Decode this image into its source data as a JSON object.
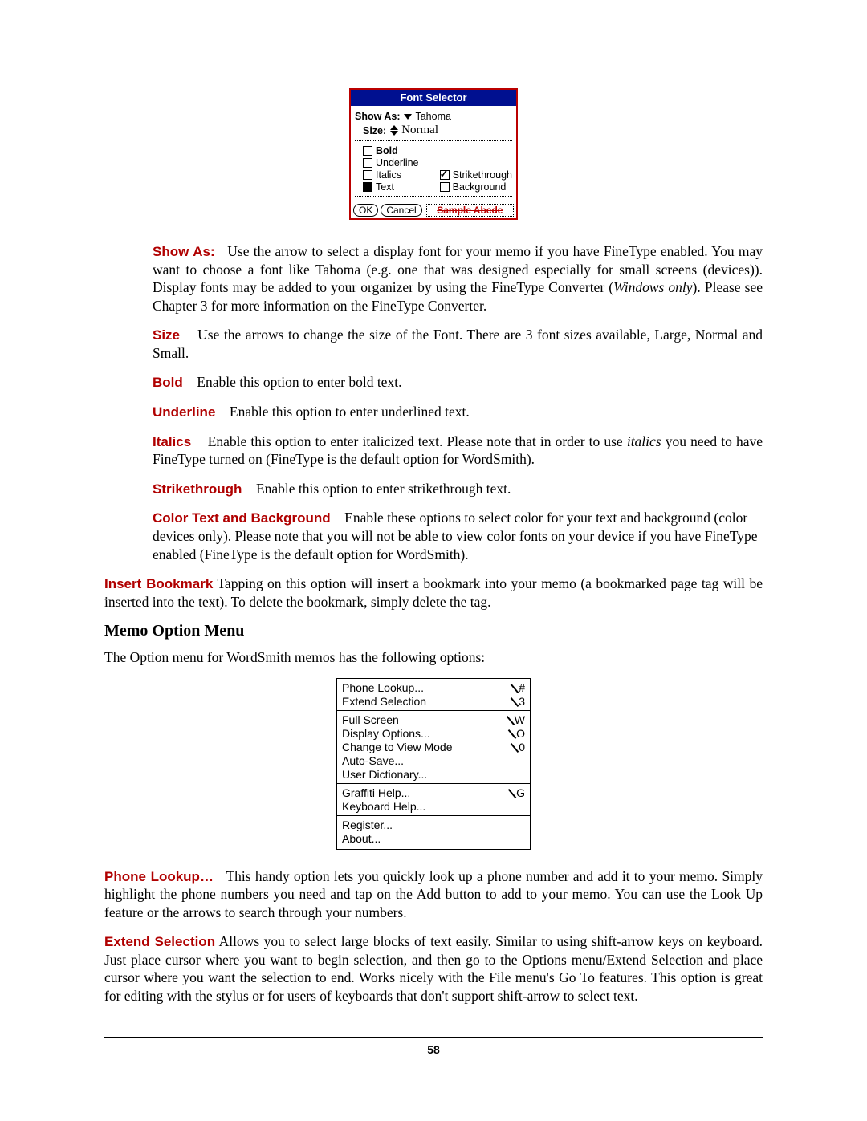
{
  "fontSelector": {
    "title": "Font Selector",
    "showAs": {
      "label": "Show As:",
      "value": "Tahoma"
    },
    "size": {
      "label": "Size:",
      "value": "Normal"
    },
    "left": {
      "bold": {
        "label": "Bold",
        "checked": false
      },
      "underline": {
        "label": "Underline",
        "checked": false
      },
      "italics": {
        "label": "Italics",
        "checked": false
      },
      "text": {
        "label": "Text",
        "filled": true
      }
    },
    "right": {
      "strike": {
        "label": "Strikethrough",
        "checked": true
      },
      "bg": {
        "label": "Background",
        "checked": false
      }
    },
    "ok": "OK",
    "cancel": "Cancel",
    "sample": "Sample   Abcde"
  },
  "p_showas": {
    "heading": "Show As:",
    "body1": "Use the arrow to select a display font for your memo if you have FineType enabled.  You may want to choose a font like Tahoma (e.g. one that was designed especially for small screens (devices)).  Display fonts may be added to your organizer by using the FineType Converter (",
    "italic": "Windows only",
    "body2": ").  Please see Chapter 3 for more information on the FineType Converter."
  },
  "p_size": {
    "heading": "Size",
    "body": "Use the arrows to change the size of the Font.  There are 3 font sizes available, Large, Normal and Small."
  },
  "p_bold": {
    "heading": "Bold",
    "body": "Enable this option to enter bold text."
  },
  "p_underline": {
    "heading": "Underline",
    "body": "Enable this option to enter underlined text."
  },
  "p_italics": {
    "heading": "Italics",
    "body1": "Enable this option to enter italicized text. Please note that in order to use ",
    "italic": "italics",
    "body2": " you need to have FineType turned on (FineType is the default option for WordSmith)."
  },
  "p_strike": {
    "heading": "Strikethrough",
    "body": "Enable this option to enter strikethrough text."
  },
  "p_color": {
    "heading": "Color Text and Background",
    "body": "Enable these options to select color for your text and background (color devices only).  Please note that you will not be able to view color fonts on your device if you have FineType enabled (FineType is the default option for WordSmith)."
  },
  "p_insert": {
    "heading": "Insert Bookmark",
    "body": " Tapping on this option will insert a bookmark into your memo (a bookmarked page tag will be inserted into the text).  To delete the bookmark, simply delete the tag."
  },
  "h_memo": "Memo Option Menu",
  "p_memo_intro": "The Option menu for WordSmith memos has the following options:",
  "optionsMenu": {
    "g1": {
      "phone": "Phone Lookup...",
      "phone_sc": "#",
      "ext": "Extend Selection",
      "ext_sc": "3"
    },
    "g2": {
      "full": "Full Screen",
      "full_sc": "W",
      "disp": "Display Options...",
      "disp_sc": "O",
      "mode": "Change to View Mode",
      "mode_sc": "0",
      "auto": "Auto-Save...",
      "dict": "User Dictionary..."
    },
    "g3": {
      "graf": "Graffiti Help...",
      "graf_sc": "G",
      "key": "Keyboard Help..."
    },
    "g4": {
      "reg": "Register...",
      "about": "About..."
    }
  },
  "p_phone": {
    "heading": "Phone Lookup…",
    "body": "This handy option lets you quickly look up a phone number and add it to your memo.  Simply highlight the phone numbers you need and tap on the Add button to add to your memo.  You can use the Look Up feature or the arrows to search through your numbers."
  },
  "p_extend": {
    "heading": "Extend Selection",
    "body": " Allows you to select large blocks of text easily. Similar to using shift-arrow keys on keyboard. Just place cursor where you want to begin selection, and then go to the Options menu/Extend Selection and place cursor where you want the selection to end. Works nicely with the File menu's Go To features. This option is great for editing with the stylus or for users of keyboards that don't support shift-arrow to select text."
  },
  "page_number": "58"
}
